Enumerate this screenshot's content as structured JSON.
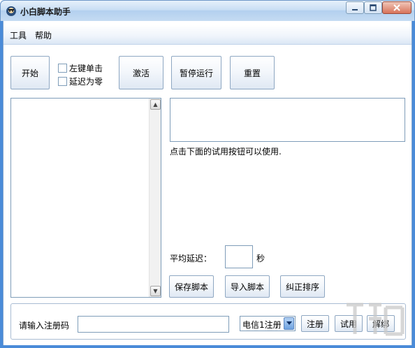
{
  "window": {
    "title": "小白脚本助手"
  },
  "menu": {
    "tools": "工具",
    "help": "帮助"
  },
  "toolbar": {
    "start": "开始",
    "left_single_click": "左键单击",
    "delay_zero": "延迟为零",
    "activate": "激活",
    "pause": "暂停运行",
    "reset": "重置"
  },
  "hint": "点击下面的试用按钮可以使用.",
  "delay": {
    "label": "平均延迟：",
    "value": "",
    "unit": "秒"
  },
  "actions": {
    "save_script": "保存脚本",
    "import_script": "导入脚本",
    "fix_order": "纠正排序"
  },
  "registration": {
    "label": "请输入注册码",
    "code": "",
    "carrier_selected": "电信1注册",
    "register": "注册",
    "trial": "试用",
    "unbind": "解绑"
  },
  "colors": {
    "titlebar": "#c9def4",
    "frame": "#4a8bd8",
    "accent": "#6fa2e0"
  }
}
